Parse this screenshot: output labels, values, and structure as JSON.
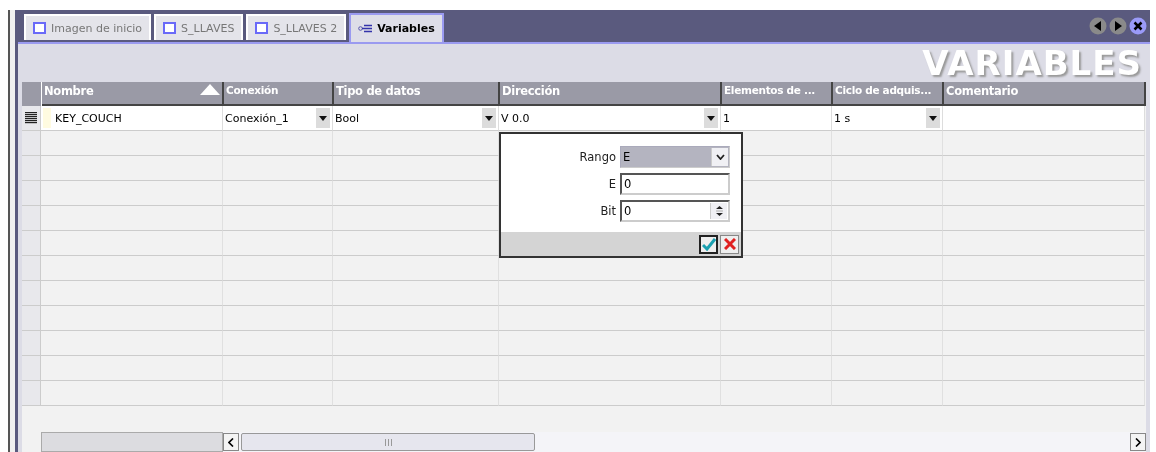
{
  "tabs": [
    {
      "label": "Imagen de inicio",
      "kind": "screen",
      "selected": false
    },
    {
      "label": "S_LLAVES",
      "kind": "screen",
      "selected": false
    },
    {
      "label": "S_LLAVES 2",
      "kind": "screen",
      "selected": false
    },
    {
      "label": "Variables",
      "kind": "tags",
      "selected": true
    }
  ],
  "title": "VARIABLES",
  "table": {
    "columns": [
      {
        "label": "Nombre",
        "sorted": true
      },
      {
        "label": "Conexión",
        "sorted": false
      },
      {
        "label": "Tipo de datos",
        "sorted": false
      },
      {
        "label": "Dirección",
        "sorted": false
      },
      {
        "label": "Elementos de ...",
        "sorted": false
      },
      {
        "label": "Ciclo de adquis...",
        "sorted": false
      },
      {
        "label": "Comentario",
        "sorted": false
      }
    ],
    "rows": [
      {
        "cells": [
          {
            "text": "KEY_COUCH",
            "kind": "text"
          },
          {
            "text": "Conexión_1",
            "kind": "dropdown"
          },
          {
            "text": "Bool",
            "kind": "dropdown"
          },
          {
            "text": "V 0.0",
            "kind": "dropdown"
          },
          {
            "text": "1",
            "kind": "text"
          },
          {
            "text": "1 s",
            "kind": "dropdown"
          },
          {
            "text": "",
            "kind": "text"
          }
        ]
      }
    ]
  },
  "address_popup": {
    "fields": [
      {
        "label": "Rango",
        "value": "E",
        "kind": "dropdown"
      },
      {
        "label": "E",
        "value": "0",
        "kind": "text"
      },
      {
        "label": "Bit",
        "value": "0",
        "kind": "spinner"
      }
    ]
  }
}
